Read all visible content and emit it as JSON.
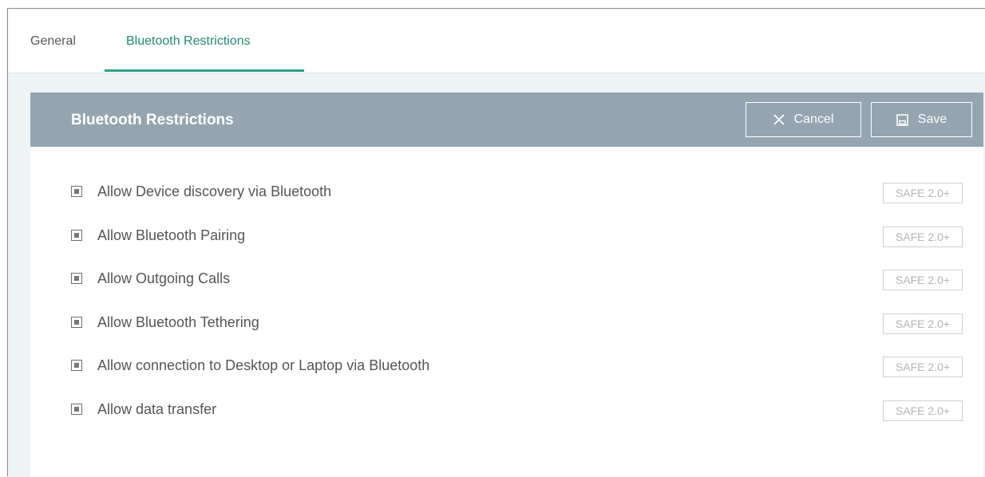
{
  "tabs": {
    "general": "General",
    "bluetooth": "Bluetooth Restrictions"
  },
  "panel": {
    "title": "Bluetooth Restrictions",
    "cancel_label": "Cancel",
    "save_label": "Save"
  },
  "options": [
    {
      "label": "Allow Device discovery via Bluetooth",
      "badge": "SAFE 2.0+"
    },
    {
      "label": "Allow Bluetooth Pairing",
      "badge": "SAFE 2.0+"
    },
    {
      "label": "Allow Outgoing Calls",
      "badge": "SAFE 2.0+"
    },
    {
      "label": "Allow Bluetooth Tethering",
      "badge": "SAFE 2.0+"
    },
    {
      "label": "Allow connection to Desktop or Laptop via Bluetooth",
      "badge": "SAFE 2.0+"
    },
    {
      "label": "Allow data transfer",
      "badge": "SAFE 2.0+"
    }
  ],
  "colors": {
    "accent": "#2e9e84",
    "header_bg": "#94a5b0",
    "content_bg": "#eef3f6"
  }
}
